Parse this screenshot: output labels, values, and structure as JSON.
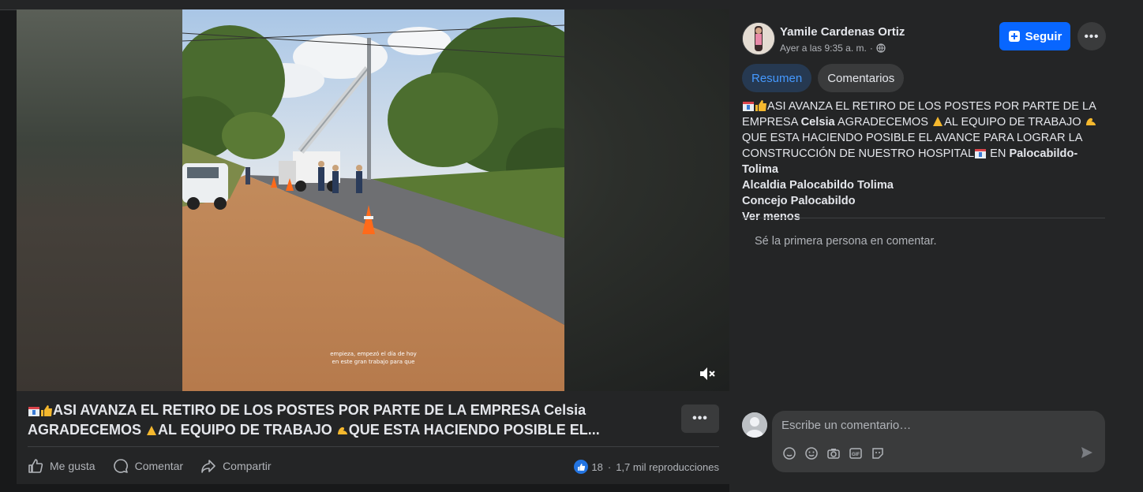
{
  "post": {
    "author": "Yamile Cardenas Ortiz",
    "timestamp": "Ayer a las 9:35 a. m.",
    "audience_icon": "globe-icon",
    "follow_label": "Seguir",
    "more_icon": "more-horizontal-icon",
    "tabs": [
      {
        "label": "Resumen",
        "active": true
      },
      {
        "label": "Comentarios",
        "active": false
      }
    ],
    "description": {
      "line1": "ASI AVANZA EL RETIRO DE LOS POSTES POR PARTE DE LA EMPRESA ",
      "company": "Celsia",
      "line2": " AGRADECEMOS ",
      "line3": "AL EQUIPO DE TRABAJO ",
      "line4": "QUE ESTA HACIENDO POSIBLE EL AVANCE PARA LOGRAR LA CONSTRUCCIÓN DE NUESTRO HOSPITAL",
      "line5": " EN ",
      "location": "Palocabildo-Tolima",
      "tag1": "Alcaldia Palocabildo Tolima",
      "tag2": "Concejo Palocabildo",
      "see_less": "Ver menos"
    },
    "empty_comments": "Sé la primera persona en comentar.",
    "comment_placeholder": "Escribe un comentario…"
  },
  "video": {
    "caption_line1": "empieza, empezó el día de hoy",
    "caption_line2": "en este gran trabajo para que",
    "mute_icon": "speaker-muted-icon",
    "title_part1": "ASI AVANZA EL RETIRO DE LOS POSTES POR PARTE DE LA EMPRESA Celsia",
    "title_part2": "AGRADECEMOS ",
    "title_part3": "AL EQUIPO DE TRABAJO ",
    "title_part4": "QUE ESTA HACIENDO POSIBLE EL...",
    "actions": {
      "like": "Me gusta",
      "comment": "Comentar",
      "share": "Compartir"
    },
    "reaction_count": "18",
    "separator": "·",
    "views": "1,7 mil reproducciones"
  },
  "colors": {
    "background": "#18191a",
    "surface": "#242526",
    "accent": "#0866ff",
    "active_tab_bg": "#263951",
    "active_tab_text": "#4599ff"
  }
}
